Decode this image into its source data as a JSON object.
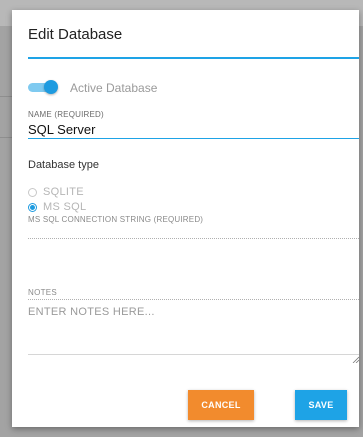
{
  "dialog": {
    "title": "Edit Database"
  },
  "active_toggle": {
    "label": "Active Database",
    "on": true
  },
  "name_field": {
    "caption": "NAME (REQUIRED)",
    "value": "SQL Server"
  },
  "database_type": {
    "label": "Database type",
    "options": [
      {
        "label": "SQLITE",
        "selected": false
      },
      {
        "label": "MS SQL",
        "selected": true
      }
    ]
  },
  "connection_field": {
    "caption": "MS SQL CONNECTION STRING (REQUIRED)",
    "value": ""
  },
  "notes_field": {
    "caption": "NOTES",
    "placeholder": "ENTER NOTES HERE..."
  },
  "actions": {
    "cancel_label": "CANCEL",
    "save_label": "SAVE"
  },
  "colors": {
    "accent": "#1ea3e6",
    "cancel": "#f28b2d"
  }
}
